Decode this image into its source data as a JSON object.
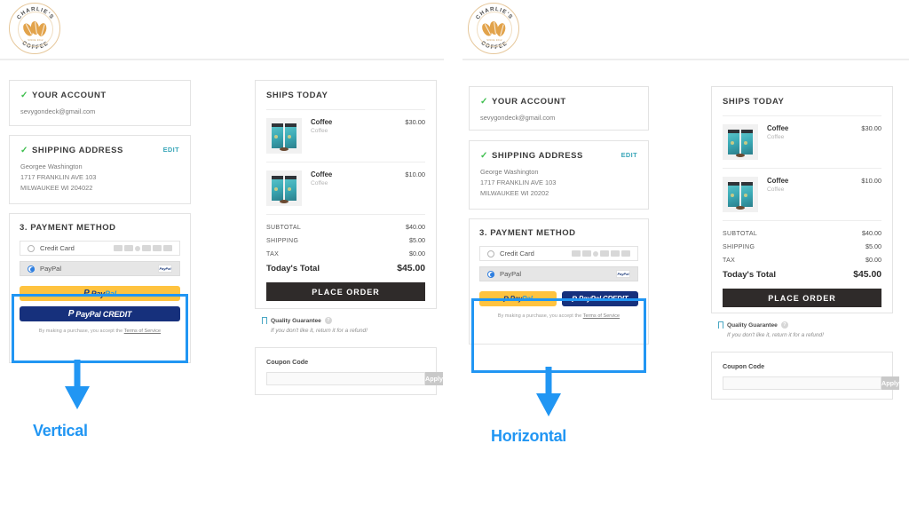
{
  "brand": {
    "name_top": "CHARLIE'S",
    "name_bottom": "COFFEE",
    "since": "SINCE 2012",
    "accent": "#e2a34b"
  },
  "annotations": {
    "accent": "#2196f3",
    "left_label": "Vertical",
    "right_label": "Horizontal"
  },
  "account": {
    "title": "YOUR ACCOUNT",
    "check": "✓",
    "email": "sevygondeck@gmail.com"
  },
  "shipping": {
    "title": "SHIPPING ADDRESS",
    "check": "✓",
    "edit": "EDIT",
    "left": {
      "name": "Georgee Washington",
      "line1": "1717 FRANKLIN AVE 103",
      "line2": "MILWAUKEE WI 204022"
    },
    "right": {
      "name": "George Washington",
      "line1": "1717 FRANKLIN AVE 103",
      "line2": "MILWAUKEE WI 20202"
    }
  },
  "payment": {
    "title": "3. PAYMENT METHOD",
    "credit_card_label": "Credit Card",
    "paypal_label": "PayPal",
    "paypal_badge": "PayPal",
    "buttons": {
      "paypal_mark": "P",
      "paypal_word_a": "Pay",
      "paypal_word_b": "Pal",
      "credit_word": "PayPal CREDIT"
    },
    "terms_prefix": "By making a purchase, you accept the ",
    "terms_link": "Terms of Service",
    "gold": "#ffc33f",
    "navy": "#16307c"
  },
  "summary": {
    "title": "SHIPS TODAY",
    "items": [
      {
        "name": "Coffee",
        "variant": "Coffee",
        "price": "$30.00"
      },
      {
        "name": "Coffee",
        "variant": "Coffee",
        "price": "$10.00"
      }
    ],
    "lines": [
      {
        "label": "SUBTOTAL",
        "value": "$40.00"
      },
      {
        "label": "SHIPPING",
        "value": "$5.00"
      },
      {
        "label": "TAX",
        "value": "$0.00"
      }
    ],
    "total_label": "Today's Total",
    "total_value": "$45.00",
    "place_order": "PLACE ORDER"
  },
  "guarantee": {
    "title": "Quality Guarantee",
    "help": "?",
    "subtitle": "If you don't like it, return it for a refund!"
  },
  "coupon": {
    "label": "Coupon Code",
    "value": "",
    "placeholder": "",
    "apply": "Apply"
  }
}
